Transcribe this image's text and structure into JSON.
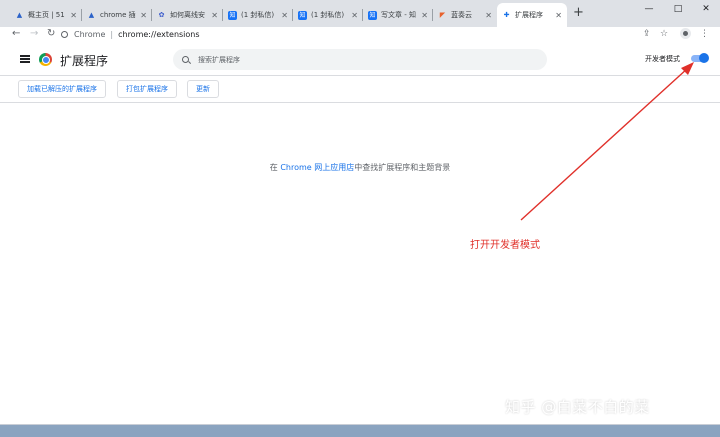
{
  "colors": {
    "accent": "#1a73e8",
    "annotation": "#e0302a",
    "tabstrip": "#dee1e6"
  },
  "tabs": [
    {
      "title": "概主页 | 51",
      "icon": "a-icon",
      "glyph": "▲",
      "color": "#2b62c9",
      "active": false
    },
    {
      "title": "chrome 插",
      "icon": "a-icon",
      "glyph": "▲",
      "color": "#2b62c9",
      "active": false
    },
    {
      "title": "如何离线安",
      "icon": "gear-icon",
      "glyph": "✿",
      "color": "#3b5bcc",
      "active": false
    },
    {
      "title": "(1 封私信)",
      "icon": "zhihu-icon",
      "glyph": "知",
      "color": "#1772f6",
      "active": false
    },
    {
      "title": "(1 封私信)",
      "icon": "zhihu-icon",
      "glyph": "知",
      "color": "#1772f6",
      "active": false
    },
    {
      "title": "写文章 - 知",
      "icon": "zhihu-icon",
      "glyph": "知",
      "color": "#1772f6",
      "active": false
    },
    {
      "title": "蓝奏云",
      "icon": "lanzou-icon",
      "glyph": "◤",
      "color": "#e8612c",
      "active": false
    },
    {
      "title": "扩展程序",
      "icon": "puzzle-icon",
      "glyph": "✚",
      "color": "#1a73e8",
      "active": true
    }
  ],
  "window_controls": {
    "minimize": "—",
    "maximize": "□",
    "close": "✕",
    "new_tab": "+"
  },
  "toolbar": {
    "back": "←",
    "forward": "→",
    "reload": "↻",
    "scheme_label": "Chrome",
    "url": "chrome://extensions",
    "share": "⇪",
    "star": "☆",
    "more": "⋮"
  },
  "header": {
    "title": "扩展程序",
    "search_placeholder": "搜索扩展程序",
    "dev_mode_label": "开发者模式",
    "dev_mode_on": true
  },
  "actions": {
    "load_unpacked": "加载已解压的扩展程序",
    "pack": "打包扩展程序",
    "update": "更新"
  },
  "main": {
    "prefix": "在 ",
    "link": "Chrome 网上应用店",
    "suffix": "中查找扩展程序和主题背景"
  },
  "annotation": {
    "text": "打开开发者模式"
  },
  "watermark": {
    "text": "知乎 @白菜不白的菜"
  }
}
